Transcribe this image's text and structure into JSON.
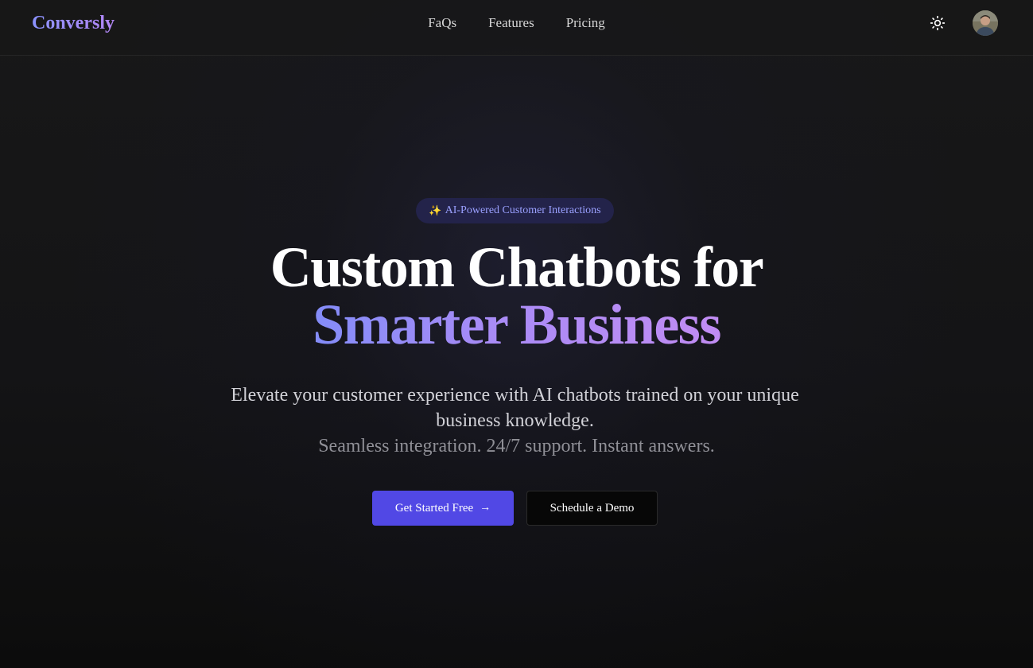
{
  "header": {
    "logo": "Conversly",
    "nav": [
      {
        "label": "FaQs"
      },
      {
        "label": "Features"
      },
      {
        "label": "Pricing"
      }
    ],
    "theme_toggle_icon": "sun-icon",
    "avatar_icon": "user-avatar"
  },
  "hero": {
    "badge": {
      "emoji": "✨",
      "text": "AI-Powered Customer Interactions"
    },
    "headline_line1": "Custom Chatbots for",
    "headline_line2": "Smarter Business",
    "subtitle": "Elevate your customer experience with AI chatbots trained on your unique business knowledge.",
    "tagline": "Seamless integration. 24/7 support. Instant answers.",
    "primary_cta": {
      "label": "Get Started Free",
      "icon": "→"
    },
    "secondary_cta": {
      "label": "Schedule a Demo"
    }
  },
  "colors": {
    "accent": "#5148e5",
    "gradient_start": "#838cf8",
    "gradient_end": "#c18cf3",
    "badge_bg": "#23234a",
    "badge_text": "#9aa0ff"
  }
}
